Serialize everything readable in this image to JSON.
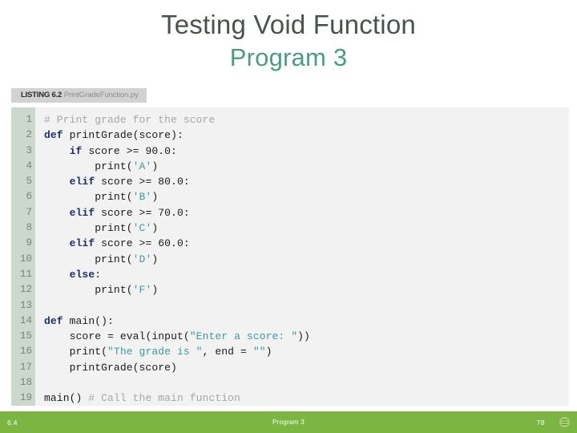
{
  "slide": {
    "title": "Testing Void Function",
    "subtitle": "Program 3"
  },
  "listing": {
    "label": "LISTING 6.2",
    "filename": "PrintGradeFunction.py"
  },
  "code": {
    "language": "python",
    "line_numbers": [
      "1",
      "2",
      "3",
      "4",
      "5",
      "6",
      "7",
      "8",
      "9",
      "10",
      "11",
      "12",
      "13",
      "14",
      "15",
      "16",
      "17",
      "18",
      "19"
    ],
    "lines": [
      "# Print grade for the score",
      "def printGrade(score):",
      "    if score >= 90.0:",
      "        print('A')",
      "    elif score >= 80.0:",
      "        print('B')",
      "    elif score >= 70.0:",
      "        print('C')",
      "    elif score >= 60.0:",
      "        print('D')",
      "    else:",
      "        print('F')",
      "",
      "def main():",
      "    score = eval(input(\"Enter a score: \"))",
      "    print(\"The grade is \", end = \"\")",
      "    printGrade(score)",
      "",
      "main() # Call the main function"
    ]
  },
  "footer": {
    "left": "6.4",
    "center": "Program 3",
    "right": "78",
    "menu_icon": "hamburger-menu-icon"
  },
  "colors": {
    "title": "#47544a",
    "subtitle": "#4a9e7c",
    "footer_bar": "#7ab641",
    "code_background": "#f2f2f2",
    "gutter": "#ccd8cc",
    "comment": "#a6a6a6",
    "keyword": "#1f2d6e",
    "string": "#3a9aa0",
    "listing_tab": "#d2d2d2"
  }
}
